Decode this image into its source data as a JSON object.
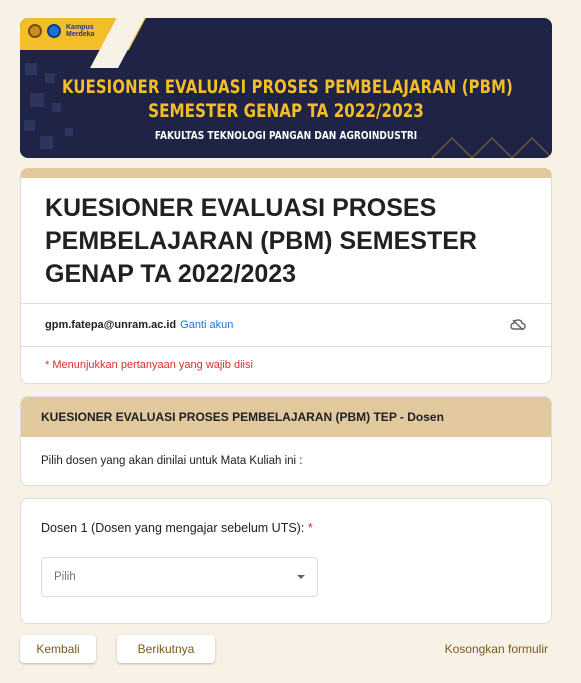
{
  "banner": {
    "logo_text_line1": "Kampus",
    "logo_text_line2": "Merdeka",
    "title_line1": "KUESIONER EVALUASI PROSES PEMBELAJARAN (PBM)",
    "title_line2": "SEMESTER GENAP TA 2022/2023",
    "subtitle": "FAKULTAS TEKNOLOGI PANGAN DAN AGROINDUSTRI",
    "accent_color": "#f3be2a",
    "bg_color": "#1f2346"
  },
  "form": {
    "title": "KUESIONER EVALUASI PROSES PEMBELAJARAN (PBM) SEMESTER GENAP TA 2022/2023",
    "account_email": "gpm.fatepa@unram.ac.id",
    "switch_account": "Ganti akun",
    "required_note": "* Menunjukkan pertanyaan yang wajib diisi",
    "cloud_icon": "cloud-off-icon"
  },
  "section": {
    "header": "KUESIONER EVALUASI PROSES PEMBELAJARAN (PBM) TEP - Dosen",
    "description": "Pilih dosen yang akan dinilai untuk Mata Kuliah ini :"
  },
  "question": {
    "label": "Dosen 1 (Dosen yang mengajar sebelum UTS):",
    "required_marker": "*",
    "select_placeholder": "Pilih"
  },
  "footer": {
    "back_label": "Kembali",
    "next_label": "Berikutnya",
    "clear_label": "Kosongkan formulir"
  }
}
